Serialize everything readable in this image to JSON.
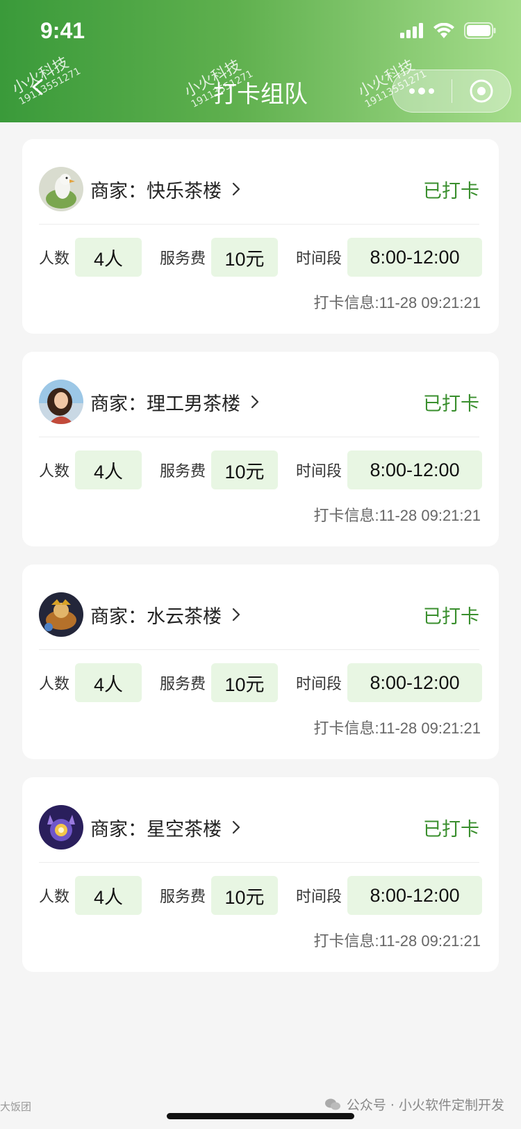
{
  "status_bar": {
    "time": "9:41"
  },
  "nav": {
    "title": "打卡组队"
  },
  "watermark": {
    "brand": "小火科技",
    "phone": "19113551271"
  },
  "colors": {
    "accent": "#3a8f2e",
    "pill_bg": "#e8f6e3",
    "header_start": "#3a9a3a",
    "header_end": "#a6dd8c"
  },
  "labels": {
    "merchant_prefix": "商家：",
    "people": "人数",
    "fee": "服务费",
    "time_slot": "时间段",
    "checkin_prefix": "打卡信息:"
  },
  "cards": [
    {
      "merchant": "快乐茶楼",
      "status": "已打卡",
      "people": "4人",
      "fee": "10元",
      "time_slot": "8:00-12:00",
      "checkin": "11-28 09:21:21",
      "avatar": "goose-avatar"
    },
    {
      "merchant": "理工男茶楼",
      "status": "已打卡",
      "people": "4人",
      "fee": "10元",
      "time_slot": "8:00-12:00",
      "checkin": "11-28 09:21:21",
      "avatar": "girl-avatar"
    },
    {
      "merchant": "水云茶楼",
      "status": "已打卡",
      "people": "4人",
      "fee": "10元",
      "time_slot": "8:00-12:00",
      "checkin": "11-28 09:21:21",
      "avatar": "game-avatar"
    },
    {
      "merchant": "星空茶楼",
      "status": "已打卡",
      "people": "4人",
      "fee": "10元",
      "time_slot": "8:00-12:00",
      "checkin": "11-28 09:21:21",
      "avatar": "robot-avatar"
    }
  ],
  "footer": {
    "account": "公众号 · 小火软件定制开发",
    "left_mark": "大饭团"
  }
}
